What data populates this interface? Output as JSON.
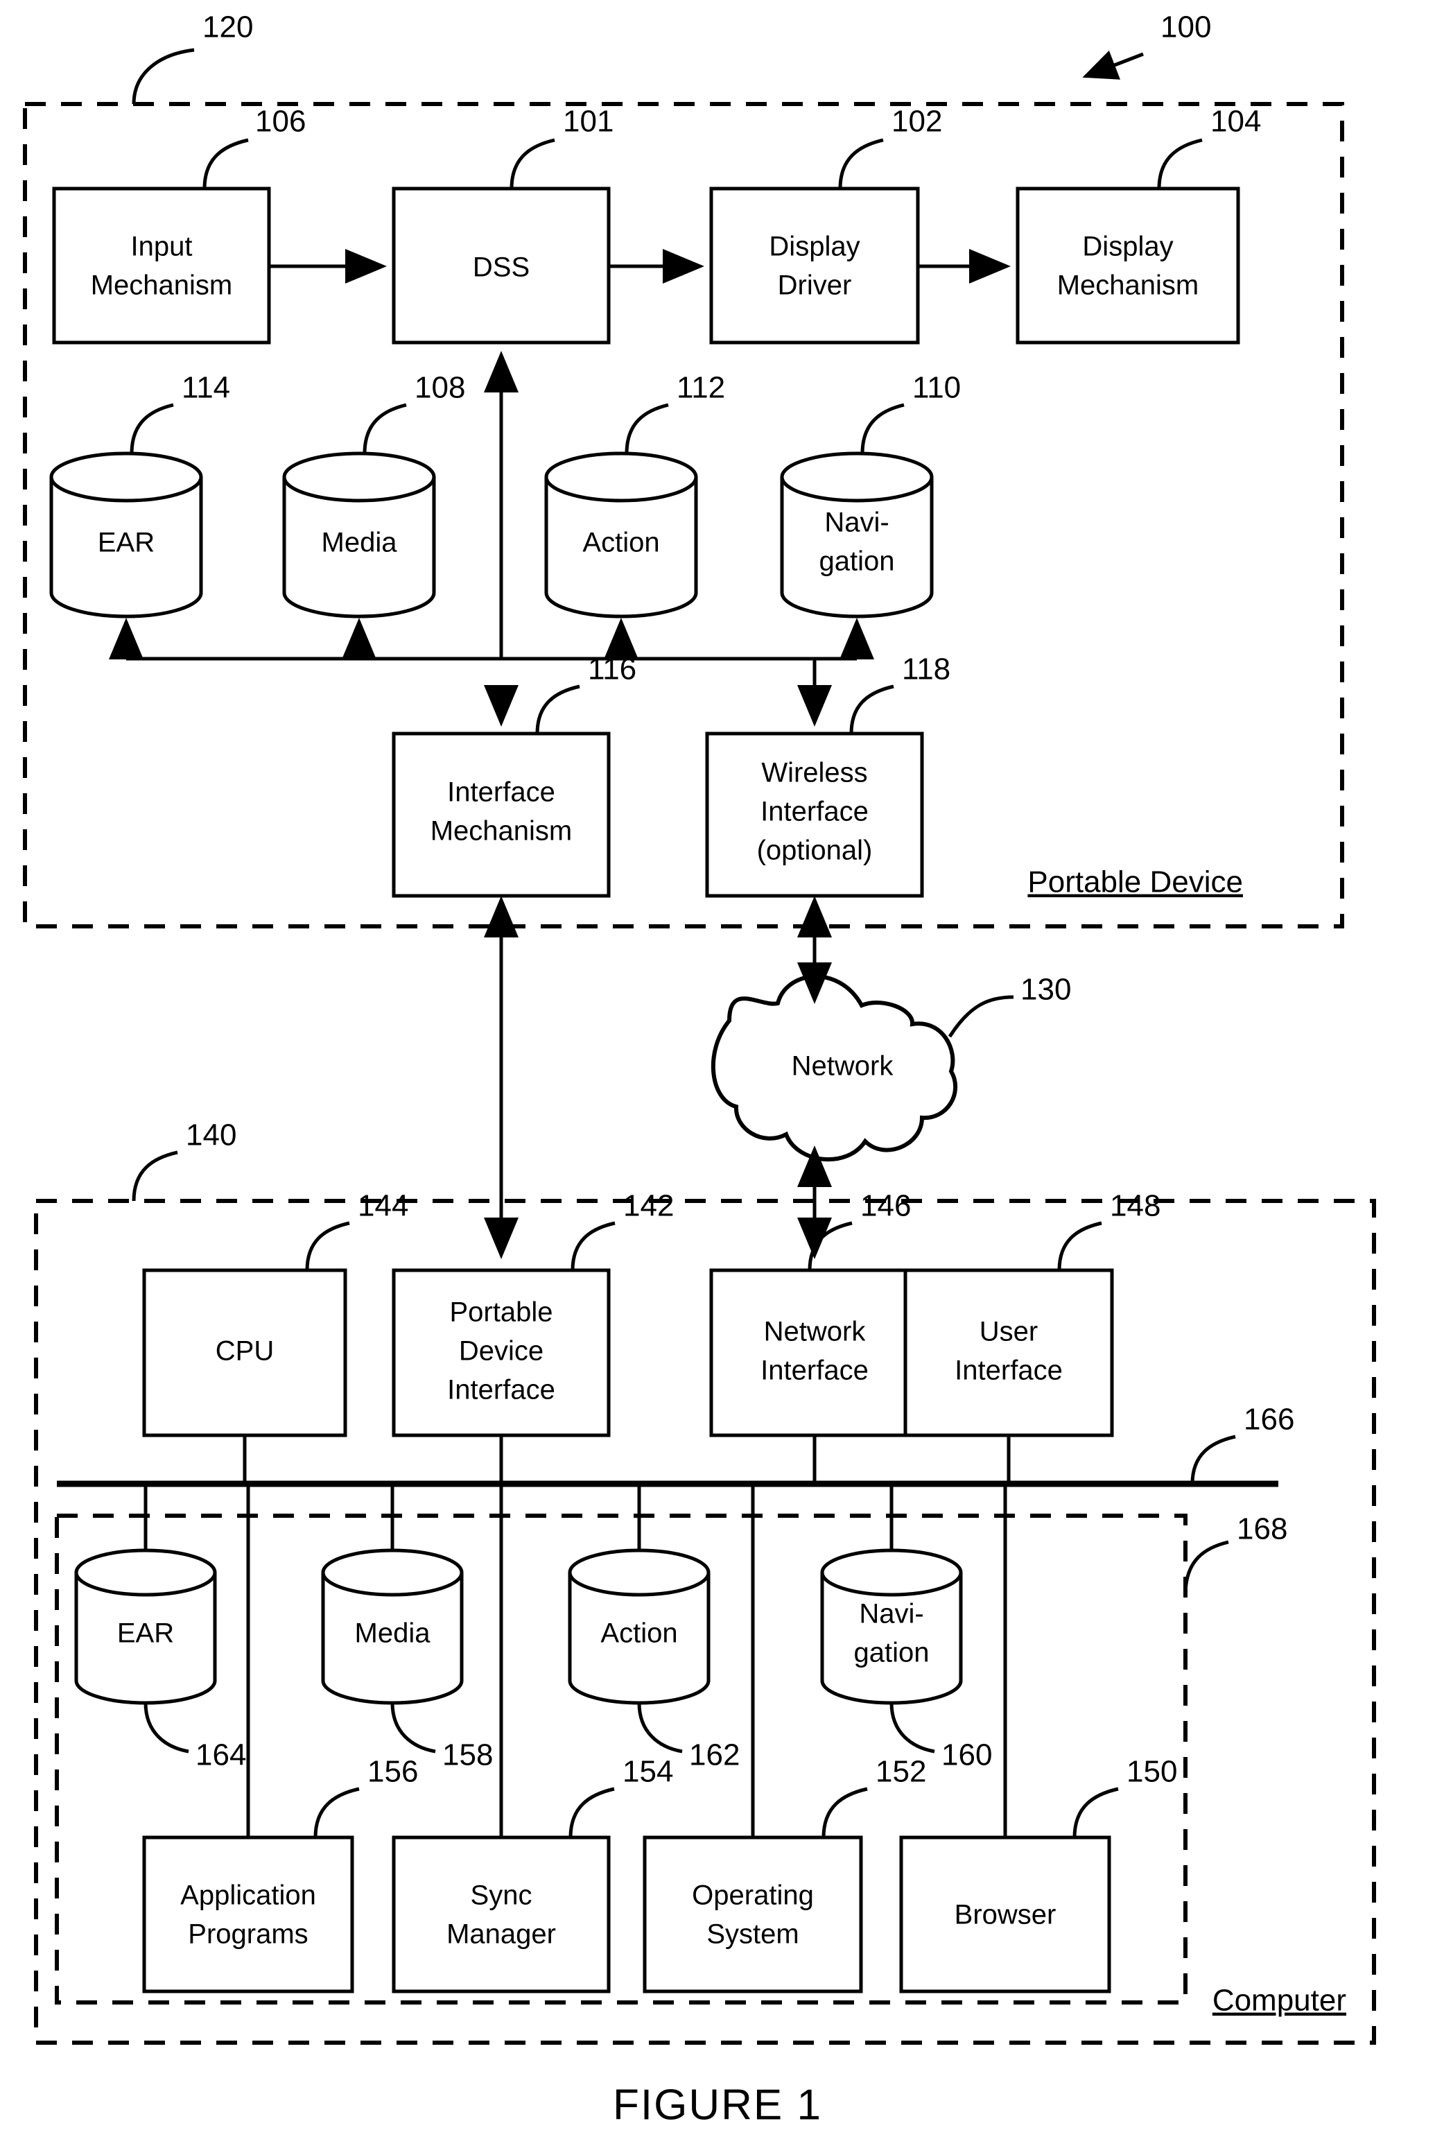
{
  "figure": {
    "caption": "FIGURE 1",
    "system_ref": "100"
  },
  "portable_device": {
    "region_label": "Portable Device",
    "region_ref": "120",
    "boxes": [
      {
        "label_line1": "Input",
        "label_line2": "Mechanism",
        "ref": "106"
      },
      {
        "label_line1": "DSS",
        "label_line2": "",
        "ref": "101"
      },
      {
        "label_line1": "Display",
        "label_line2": "Driver",
        "ref": "102"
      },
      {
        "label_line1": "Display",
        "label_line2": "Mechanism",
        "ref": "104"
      }
    ],
    "databases": [
      {
        "label_line1": "EAR",
        "label_line2": "",
        "ref": "114"
      },
      {
        "label_line1": "Media",
        "label_line2": "",
        "ref": "108"
      },
      {
        "label_line1": "Action",
        "label_line2": "",
        "ref": "112"
      },
      {
        "label_line1": "Navi-",
        "label_line2": "gation",
        "ref": "110"
      }
    ],
    "interfaces": [
      {
        "label_line1": "Interface",
        "label_line2": "Mechanism",
        "label_line3": "",
        "ref": "116"
      },
      {
        "label_line1": "Wireless",
        "label_line2": "Interface",
        "label_line3": "(optional)",
        "ref": "118"
      }
    ]
  },
  "network": {
    "label": "Network",
    "ref": "130"
  },
  "computer": {
    "region_label": "Computer",
    "region_ref": "140",
    "inner_region_ref": "168",
    "bus_ref": "166",
    "top_boxes": [
      {
        "label_line1": "CPU",
        "label_line2": "",
        "label_line3": "",
        "ref": "144"
      },
      {
        "label_line1": "Portable",
        "label_line2": "Device",
        "label_line3": "Interface",
        "ref": "142"
      },
      {
        "label_line1": "Network",
        "label_line2": "Interface",
        "label_line3": "",
        "ref": "146"
      },
      {
        "label_line1": "User",
        "label_line2": "Interface",
        "label_line3": "",
        "ref": "148"
      }
    ],
    "databases": [
      {
        "label_line1": "EAR",
        "label_line2": "",
        "ref": "164"
      },
      {
        "label_line1": "Media",
        "label_line2": "",
        "ref": "158"
      },
      {
        "label_line1": "Action",
        "label_line2": "",
        "ref": "162"
      },
      {
        "label_line1": "Navi-",
        "label_line2": "gation",
        "ref": "160"
      }
    ],
    "bottom_boxes": [
      {
        "label_line1": "Application",
        "label_line2": "Programs",
        "ref": "156"
      },
      {
        "label_line1": "Sync",
        "label_line2": "Manager",
        "ref": "154"
      },
      {
        "label_line1": "Operating",
        "label_line2": "System",
        "ref": "152"
      },
      {
        "label_line1": "Browser",
        "label_line2": "",
        "ref": "150"
      }
    ]
  }
}
